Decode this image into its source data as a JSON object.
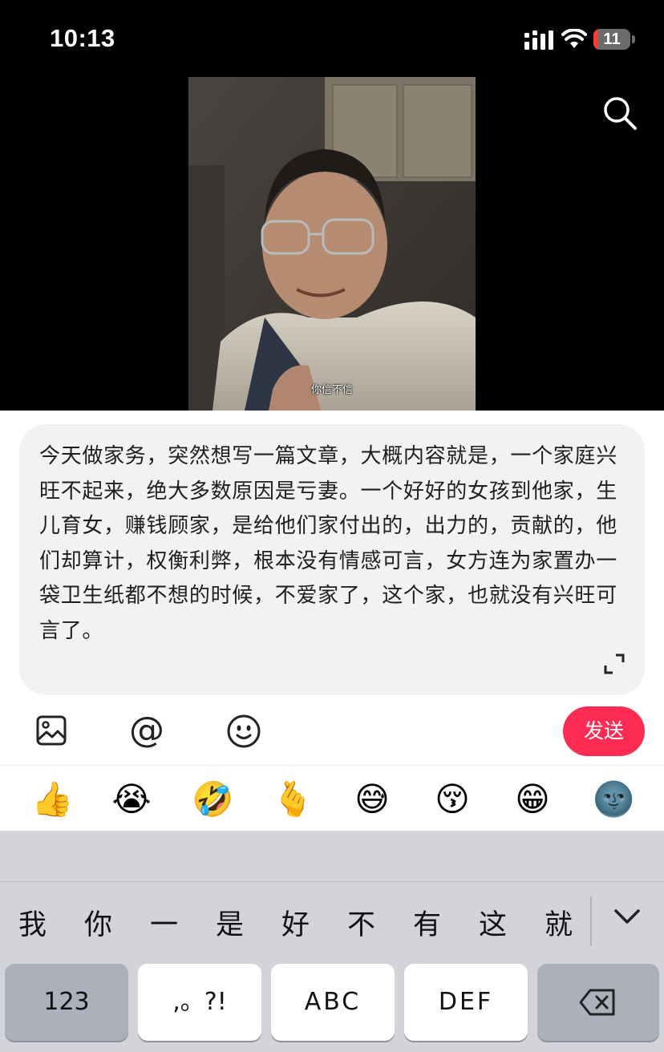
{
  "status_bar": {
    "time": "10:13",
    "battery": "11"
  },
  "video": {
    "subtitle": "你信不信"
  },
  "compose": {
    "text": "今天做家务，突然想写一篇文章，大概内容就是，一个家庭兴旺不起来，绝大多数原因是亏妻。一个好好的女孩到他家，生儿育女，赚钱顾家，是给他们家付出的，出力的，贡献的，他们却算计，权衡利弊，根本没有情感可言，女方连为家置办一袋卫生纸都不想的时候，不爱家了，这个家，也就没有兴旺可言了。",
    "mention_symbol": "@",
    "send_label": "发送"
  },
  "emoji_bar": [
    "👍",
    "😭",
    "🤣",
    "🫰",
    "😅",
    "😚",
    "😁",
    "🌚"
  ],
  "keyboard": {
    "candidates": [
      "我",
      "你",
      "一",
      "是",
      "好",
      "不",
      "有",
      "这",
      "就"
    ],
    "keys": {
      "numbers": "123",
      "punct": ",。?!",
      "abc": "ABC",
      "def": "DEF"
    }
  },
  "colors": {
    "send_button": "#fe2c55",
    "battery_low": "#ff3b30"
  }
}
